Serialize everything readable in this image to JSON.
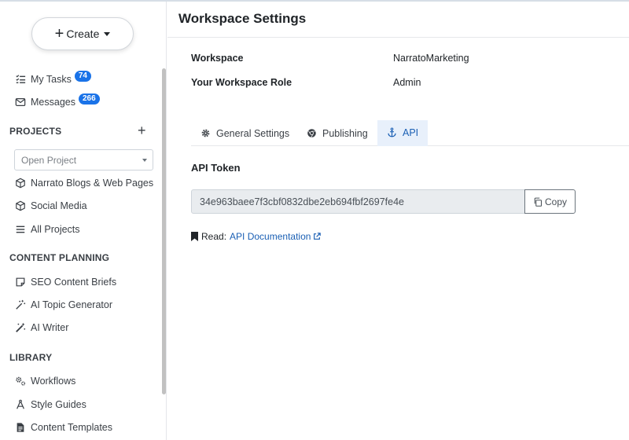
{
  "sidebar": {
    "create_label": "Create",
    "nav_top": [
      {
        "label": "My Tasks",
        "badge": "74",
        "icon": "task-list-icon"
      },
      {
        "label": "Messages",
        "badge": "266",
        "icon": "envelope-icon"
      }
    ],
    "projects": {
      "title": "PROJECTS",
      "add_icon": "plus-icon",
      "open_placeholder": "Open Project",
      "items": [
        {
          "label": "Narrato Blogs & Web Pages",
          "icon": "cube-icon"
        },
        {
          "label": "Social Media",
          "icon": "cube-icon"
        },
        {
          "label": "All Projects",
          "icon": "list-icon"
        }
      ]
    },
    "content_planning": {
      "title": "CONTENT PLANNING",
      "items": [
        {
          "label": "SEO Content Briefs",
          "icon": "note-icon"
        },
        {
          "label": "AI Topic Generator",
          "icon": "sparkle-wand-icon"
        },
        {
          "label": "AI Writer",
          "icon": "magic-wand-icon"
        }
      ]
    },
    "library": {
      "title": "LIBRARY",
      "items": [
        {
          "label": "Workflows",
          "icon": "gears-icon"
        },
        {
          "label": "Style Guides",
          "icon": "compass-pen-icon"
        },
        {
          "label": "Content Templates",
          "icon": "document-icon"
        }
      ]
    }
  },
  "main": {
    "title": "Workspace Settings",
    "info": [
      {
        "label": "Workspace",
        "value": "NarratoMarketing"
      },
      {
        "label": "Your Workspace Role",
        "value": "Admin"
      }
    ],
    "tabs": [
      {
        "label": "General Settings",
        "icon": "gear-icon",
        "active": false
      },
      {
        "label": "Publishing",
        "icon": "chrome-icon",
        "active": false
      },
      {
        "label": "API",
        "icon": "anchor-icon",
        "active": true
      }
    ],
    "api_section": {
      "heading": "API Token",
      "token": "34e963baee7f3cbf0832dbe2eb694fbf2697fe4e",
      "copy_label": "Copy",
      "read_prefix": "Read:",
      "doc_link": "API Documentation"
    }
  },
  "colors": {
    "accent": "#1a73e8",
    "active_tab_bg": "#e8f0fb",
    "link": "#1a5fb4"
  }
}
